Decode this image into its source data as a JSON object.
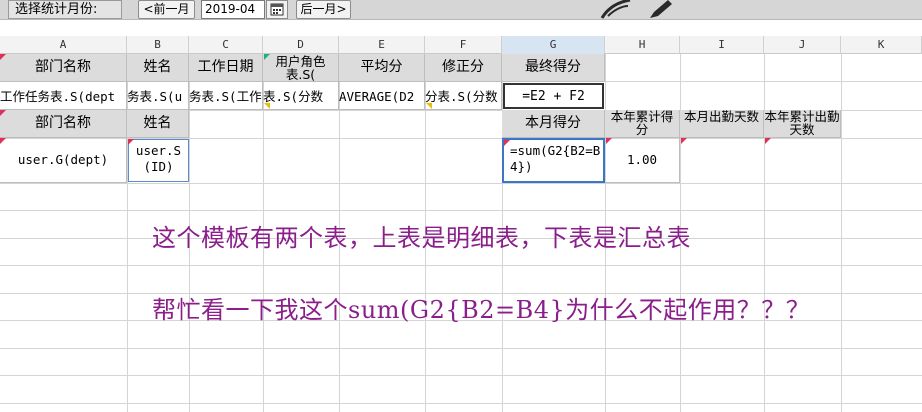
{
  "toolbar": {
    "month_label": "选择统计月份:",
    "prev_label": "<前一月",
    "month_value": "2019-04",
    "next_label": "后一月>"
  },
  "columns": [
    "A",
    "B",
    "C",
    "D",
    "E",
    "F",
    "G",
    "H",
    "I",
    "J",
    "K"
  ],
  "detail_headers": {
    "dept": "部门名称",
    "name": "姓名",
    "work_date": "工作日期",
    "user_role": "用户角色表.S(",
    "avg": "平均分",
    "correction": "修正分",
    "final": "最终得分"
  },
  "detail_row": {
    "dept": "工作任务表.S(dept",
    "name": "务表.S(u",
    "work_date": "务表.S(工作",
    "user_role": "表.S(分数",
    "avg": "AVERAGE(D2",
    "correction": "分表.S(分数",
    "final": "=E2 + F2"
  },
  "summary_headers": {
    "dept": "部门名称",
    "name": "姓名",
    "month_score": "本月得分",
    "year_score": "本年累计得分",
    "month_attend": "本月出勤天数",
    "year_attend": "本年累计出勤天数"
  },
  "summary_row": {
    "dept": "user.G(dept)",
    "name": "user.S(ID)",
    "month_score": "=sum(G2{B2=B4})",
    "year_score": "1.00"
  },
  "notes": {
    "line1": "这个模板有两个表，上表是明细表，下表是汇总表",
    "line2": "帮忙看一下我这个sum(G2{B2=B4}为什么不起作用？？？"
  },
  "colors": {
    "note_text": "#8b1e8b",
    "selection_border": "#3c76c4",
    "header_fill": "#dcdcdc"
  },
  "icons": [
    "calendar-icon",
    "feather-icon",
    "pen-icon"
  ]
}
